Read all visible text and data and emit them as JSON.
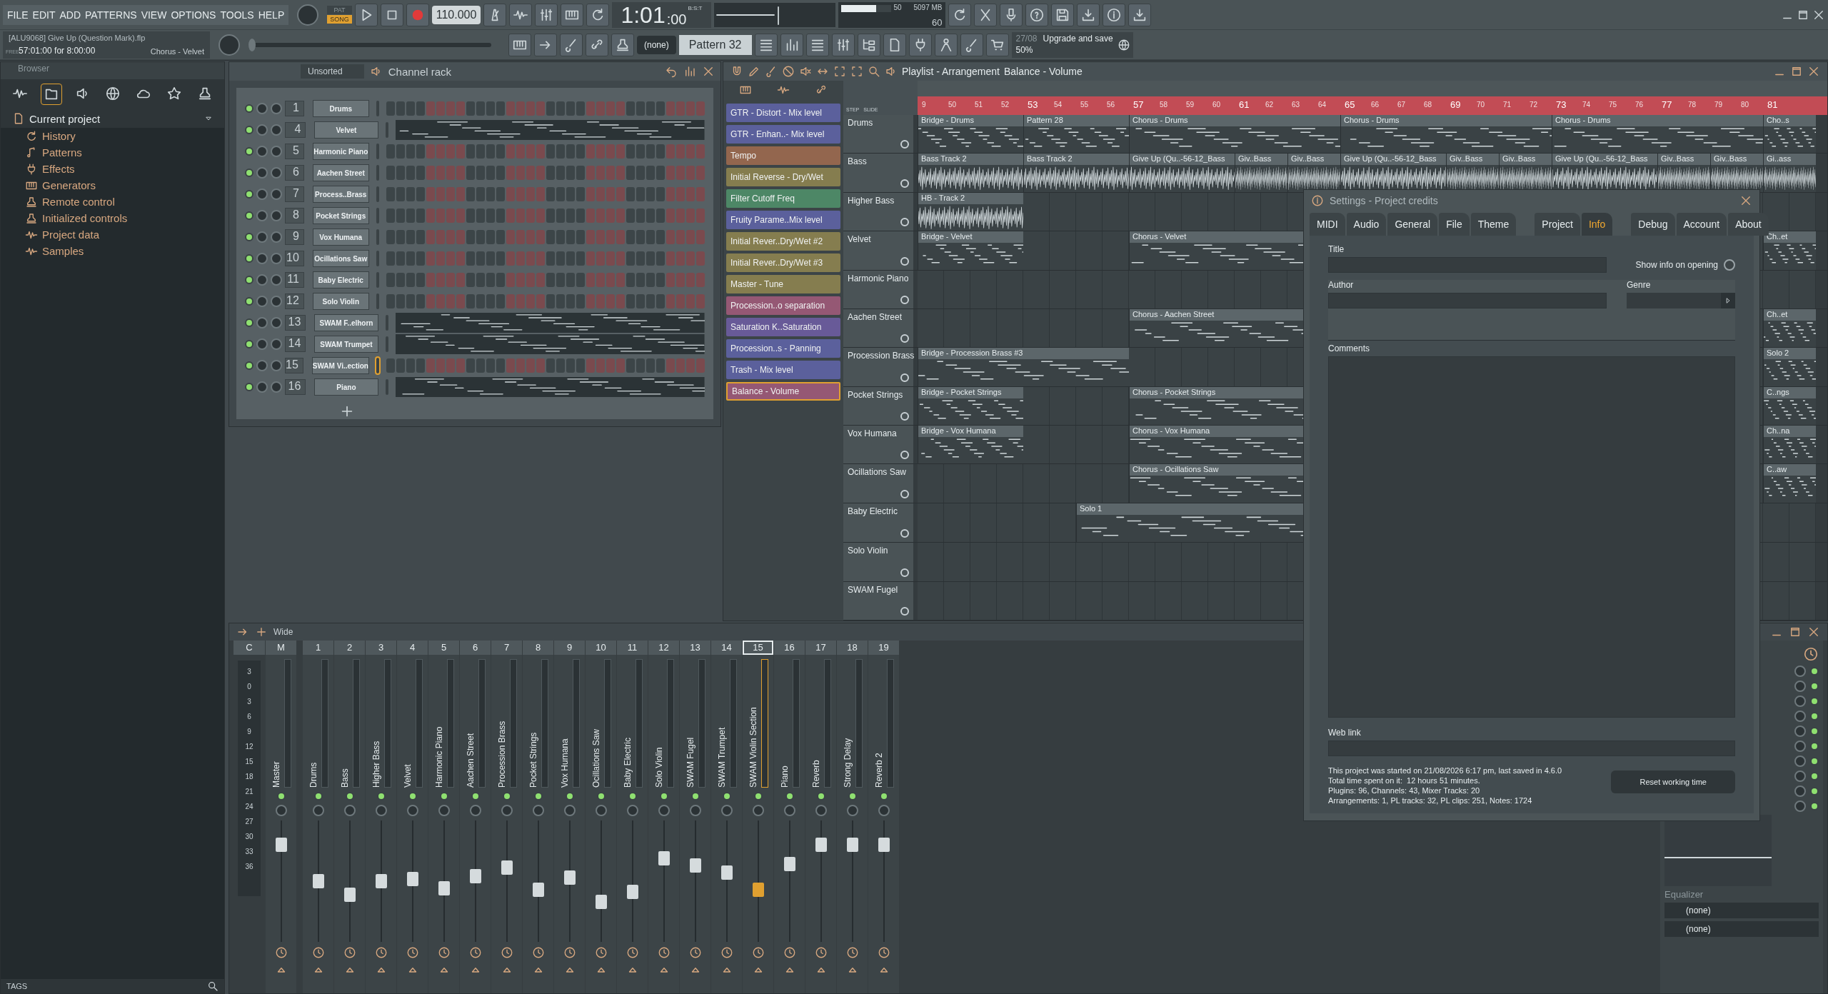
{
  "menu": [
    "FILE",
    "EDIT",
    "ADD",
    "PATTERNS",
    "VIEW",
    "OPTIONS",
    "TOOLS",
    "HELP"
  ],
  "transport": {
    "modes": [
      {
        "label": "PAT",
        "selected": false
      },
      {
        "label": "SONG",
        "selected": true
      }
    ],
    "tempo": "110.000",
    "time": "1:01",
    "time_sub": ":00",
    "time_unit": "B:S:T"
  },
  "monitor": {
    "cpu": "50",
    "memory": "5097 MB",
    "polyphony": "60",
    "level": 0.7
  },
  "song": {
    "file": "[ALU9068] Give Up (Question Mark).flp",
    "badge": "FREE",
    "position": "57:01:00 for 8:00:00",
    "pattern": "Chorus - Velvet",
    "level": 0
  },
  "pattern_bar": {
    "selector": "(none)",
    "pattern": "Pattern 32"
  },
  "news": {
    "date": "27/08",
    "text": "Upgrade and save",
    "progress": "50%"
  },
  "browser": {
    "title": "Browser",
    "tree": [
      {
        "label": "Current project",
        "expanded": true,
        "children": [
          {
            "label": "History"
          },
          {
            "label": "Patterns"
          },
          {
            "label": "Effects"
          },
          {
            "label": "Generators"
          },
          {
            "label": "Remote control"
          },
          {
            "label": "Initialized controls"
          },
          {
            "label": "Project data"
          },
          {
            "label": "Samples"
          }
        ]
      }
    ],
    "tags": "TAGS"
  },
  "channel_rack": {
    "filter": "Unsorted",
    "title": "Channel rack",
    "channels": [
      {
        "number": "1",
        "name": "Drums",
        "kind": "steps",
        "selected": false
      },
      {
        "number": "4",
        "name": "Velvet",
        "kind": "notes",
        "selected": false
      },
      {
        "number": "5",
        "name": "Harmonic Piano",
        "kind": "steps",
        "selected": false
      },
      {
        "number": "6",
        "name": "Aachen Street",
        "kind": "steps",
        "selected": false
      },
      {
        "number": "7",
        "name": "Process..Brass",
        "kind": "steps",
        "selected": false
      },
      {
        "number": "8",
        "name": "Pocket Strings",
        "kind": "steps",
        "selected": false
      },
      {
        "number": "9",
        "name": "Vox Humana",
        "kind": "steps",
        "selected": false
      },
      {
        "number": "10",
        "name": "Ocillations Saw",
        "kind": "steps",
        "selected": false
      },
      {
        "number": "11",
        "name": "Baby Electric",
        "kind": "steps",
        "selected": false
      },
      {
        "number": "12",
        "name": "Solo Violin",
        "kind": "steps",
        "selected": false
      },
      {
        "number": "13",
        "name": "SWAM F..elhorn",
        "kind": "notes",
        "selected": false
      },
      {
        "number": "14",
        "name": "SWAM Trumpet",
        "kind": "notes",
        "selected": false
      },
      {
        "number": "15",
        "name": "SWAM Vi..ection",
        "kind": "steps",
        "selected": true
      },
      {
        "number": "16",
        "name": "Piano",
        "kind": "notes",
        "selected": false
      }
    ]
  },
  "playlist": {
    "title": "Playlist - Arrangement",
    "current": "Balance - Volume",
    "step_label": "STEP",
    "slide_label": "SLIDE",
    "automation_clips": [
      {
        "label": "GTR - Distort - Mix level",
        "color": "#5b609c",
        "selected": false
      },
      {
        "label": "GTR - Enhan..- Mix level",
        "color": "#5b609c",
        "selected": false
      },
      {
        "label": "Tempo",
        "color": "#93664e",
        "selected": false
      },
      {
        "label": "Initial Reverse - Dry/Wet",
        "color": "#857d4f",
        "selected": false
      },
      {
        "label": "Filter Cutoff Freq",
        "color": "#4d8766",
        "selected": false
      },
      {
        "label": "Fruity Parame..Mix level",
        "color": "#5b609c",
        "selected": false
      },
      {
        "label": "Initial Rever..Dry/Wet #2",
        "color": "#857d4f",
        "selected": false
      },
      {
        "label": "Initial Rever..Dry/Wet #3",
        "color": "#857d4f",
        "selected": false
      },
      {
        "label": "Master - Tune",
        "color": "#857d4f",
        "selected": false
      },
      {
        "label": "Procession..o separation",
        "color": "#955874",
        "selected": false
      },
      {
        "label": "Saturation K..Saturation",
        "color": "#685a98",
        "selected": false
      },
      {
        "label": "Procession..s - Panning",
        "color": "#5b609c",
        "selected": false
      },
      {
        "label": "Trash - Mix level",
        "color": "#5b609c",
        "selected": false
      },
      {
        "label": "Balance - Volume",
        "color": "#955874",
        "selected": true
      }
    ],
    "ruler": [
      "9",
      "50",
      "51",
      "52",
      "53",
      "54",
      "55",
      "56",
      "57",
      "58",
      "59",
      "60",
      "61",
      "62",
      "63",
      "64",
      "65",
      "66",
      "67",
      "68",
      "69",
      "70",
      "71",
      "72",
      "73",
      "74",
      "75",
      "76",
      "77",
      "78",
      "79",
      "80",
      "81"
    ],
    "tracks": [
      {
        "name": "Drums",
        "clips": [
          {
            "label": "Bridge - Drums",
            "kind": "pattern"
          },
          {
            "label": "Pattern 28",
            "kind": "pattern"
          },
          {
            "label": "Chorus - Drums",
            "kind": "pattern"
          },
          {
            "label": "Chorus - Drums",
            "kind": "pattern"
          },
          {
            "label": "Chorus - Drums",
            "kind": "pattern"
          },
          {
            "label": "Cho..s",
            "kind": "pattern"
          }
        ]
      },
      {
        "name": "Bass",
        "clips": [
          {
            "label": "Bass Track 2",
            "kind": "audio"
          },
          {
            "label": "Bass Track 2",
            "kind": "audio"
          },
          {
            "label": "Give Up (Qu..-56-12_Bass",
            "kind": "audio"
          },
          {
            "label": "Giv..Bass",
            "kind": "audio"
          },
          {
            "label": "Giv..Bass",
            "kind": "audio"
          },
          {
            "label": "Give Up (Qu..-56-12_Bass",
            "kind": "audio"
          },
          {
            "label": "Giv..Bass",
            "kind": "audio"
          },
          {
            "label": "Giv..Bass",
            "kind": "audio"
          },
          {
            "label": "Give Up (Qu..-56-12_Bass",
            "kind": "audio"
          },
          {
            "label": "Giv..Bass",
            "kind": "audio"
          },
          {
            "label": "Giv..Bass",
            "kind": "audio"
          },
          {
            "label": "Gi..ass",
            "kind": "audio"
          }
        ]
      },
      {
        "name": "Higher Bass",
        "clips": [
          {
            "label": "HB - Track 2",
            "kind": "audio"
          }
        ]
      },
      {
        "name": "Velvet",
        "clips": [
          {
            "label": "Bridge - Velvet",
            "kind": "pattern"
          },
          {
            "label": "Chorus - Velvet",
            "kind": "pattern"
          },
          {
            "label": "Ch..et",
            "kind": "pattern"
          }
        ]
      },
      {
        "name": "Harmonic Piano"
      },
      {
        "name": "Aachen Street",
        "clips": [
          {
            "label": "Chorus - Aachen Street",
            "kind": "pattern"
          },
          {
            "label": "Ch..et",
            "kind": "pattern"
          }
        ]
      },
      {
        "name": "Procession Brass",
        "clips": [
          {
            "label": "Bridge - Procession Brass #3",
            "kind": "pattern"
          },
          {
            "label": "Solo 2",
            "kind": "pattern"
          }
        ]
      },
      {
        "name": "Pocket Strings",
        "clips": [
          {
            "label": "Bridge - Pocket Strings",
            "kind": "pattern"
          },
          {
            "label": "Chorus - Pocket Strings",
            "kind": "pattern"
          },
          {
            "label": "C..ngs",
            "kind": "pattern"
          }
        ]
      },
      {
        "name": "Vox Humana",
        "clips": [
          {
            "label": "Bridge - Vox Humana",
            "kind": "pattern"
          },
          {
            "label": "Chorus - Vox Humana",
            "kind": "pattern"
          },
          {
            "label": "Ch..na",
            "kind": "pattern"
          }
        ]
      },
      {
        "name": "Ocillations Saw",
        "clips": [
          {
            "label": "Chorus - Ocillations Saw",
            "kind": "pattern"
          },
          {
            "label": "C..aw",
            "kind": "pattern"
          }
        ]
      },
      {
        "name": "Baby Electric",
        "clips": [
          {
            "label": "Solo 1",
            "kind": "pattern"
          }
        ]
      },
      {
        "name": "Solo Violin"
      },
      {
        "name": "SWAM Fugel"
      }
    ]
  },
  "settings": {
    "title": "Settings - Project credits",
    "tabs": [
      {
        "label": "MIDI",
        "selected": false
      },
      {
        "label": "Audio",
        "selected": false
      },
      {
        "label": "General",
        "selected": false
      },
      {
        "label": "File",
        "selected": false
      },
      {
        "label": "Theme",
        "selected": false
      },
      {
        "label": "Project",
        "selected": false
      },
      {
        "label": "Info",
        "selected": true
      },
      {
        "label": "Debug",
        "selected": false
      },
      {
        "label": "Account",
        "selected": false
      },
      {
        "label": "About",
        "selected": false
      }
    ],
    "title_label": "Title",
    "show_info": {
      "label": "Show info on opening",
      "on": false
    },
    "author_label": "Author",
    "genre_label": "Genre",
    "comments_label": "Comments",
    "web_link_label": "Web link",
    "info_lines": [
      "This project was started on 21/08/2026 6:17 pm, last saved in 4.6.0",
      "Total time spent on it:  12 hours 51 minutes.",
      "Plugins: 96, Channels: 43, Mixer Tracks: 20",
      "Arrangements: 1, PL tracks: 32, PL clips: 251, Notes: 1724"
    ],
    "reset_button": "Reset working time"
  },
  "mixer": {
    "toolbar_label": "Wide",
    "scale_header": "C",
    "scale": [
      "3",
      "0",
      "3",
      "6",
      "9",
      "12",
      "15",
      "18",
      "21",
      "24",
      "27",
      "30",
      "33",
      "36"
    ],
    "inserts": [
      {
        "number": "M",
        "name": "Master",
        "level": 0.8,
        "selected": false
      },
      {
        "number": "1",
        "name": "Drums",
        "level": 0.5,
        "selected": false
      },
      {
        "number": "2",
        "name": "Bass",
        "level": 0.39,
        "selected": false
      },
      {
        "number": "3",
        "name": "Higher Bass",
        "level": 0.5,
        "selected": false
      },
      {
        "number": "4",
        "name": "Velvet",
        "level": 0.52,
        "selected": false
      },
      {
        "number": "5",
        "name": "Harmonic Piano",
        "level": 0.44,
        "selected": false
      },
      {
        "number": "6",
        "name": "Aachen Street",
        "level": 0.54,
        "selected": false
      },
      {
        "number": "7",
        "name": "Procession Brass",
        "level": 0.61,
        "selected": false
      },
      {
        "number": "8",
        "name": "Pocket Strings",
        "level": 0.43,
        "selected": false
      },
      {
        "number": "9",
        "name": "Vox Humana",
        "level": 0.53,
        "selected": false
      },
      {
        "number": "10",
        "name": "Ocillations Saw",
        "level": 0.33,
        "selected": false
      },
      {
        "number": "11",
        "name": "Baby Electric",
        "level": 0.41,
        "selected": false
      },
      {
        "number": "12",
        "name": "Solo Violin",
        "level": 0.69,
        "selected": false
      },
      {
        "number": "13",
        "name": "SWAM Fugel",
        "level": 0.63,
        "selected": false
      },
      {
        "number": "14",
        "name": "SWAM Trumpet",
        "level": 0.57,
        "selected": false
      },
      {
        "number": "15",
        "name": "SWAM Violin Section",
        "level": 0.43,
        "selected": true
      },
      {
        "number": "16",
        "name": "Piano",
        "level": 0.64,
        "selected": false
      },
      {
        "number": "17",
        "name": "Reverb",
        "level": 0.8,
        "selected": false
      },
      {
        "number": "18",
        "name": "Strong Delay",
        "level": 0.8,
        "selected": false
      },
      {
        "number": "19",
        "name": "Reverb 2",
        "level": 0.8,
        "selected": false
      }
    ],
    "effect": "Equalizer",
    "slots": [
      "(none)",
      "(none)"
    ]
  }
}
